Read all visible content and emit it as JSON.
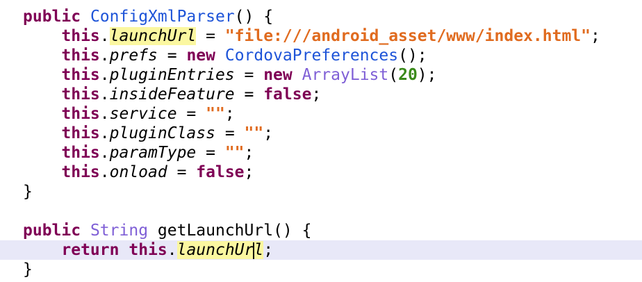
{
  "code": {
    "l1": {
      "kw": "public",
      "name": "ConfigXmlParser",
      "rest": "() {"
    },
    "l2": {
      "this": "this",
      "dot": ".",
      "field": "launchUrl",
      "eq": " = ",
      "value": "\"file:///android_asset/www/index.html\"",
      "end": ";"
    },
    "l3": {
      "this": "this",
      "dot": ".",
      "field": "prefs",
      "eq": " = ",
      "new": "new",
      "type": "CordovaPreferences",
      "end": "();"
    },
    "l4": {
      "this": "this",
      "dot": ".",
      "field": "pluginEntries",
      "eq": " = ",
      "new": "new",
      "type": "ArrayList",
      "open": "(",
      "num": "20",
      "end": ");"
    },
    "l5": {
      "this": "this",
      "dot": ".",
      "field": "insideFeature",
      "eq": " = ",
      "value": "false",
      "end": ";"
    },
    "l6": {
      "this": "this",
      "dot": ".",
      "field": "service",
      "eq": " = ",
      "value": "\"\"",
      "end": ";"
    },
    "l7": {
      "this": "this",
      "dot": ".",
      "field": "pluginClass",
      "eq": " = ",
      "value": "\"\"",
      "end": ";"
    },
    "l8": {
      "this": "this",
      "dot": ".",
      "field": "paramType",
      "eq": " = ",
      "value": "\"\"",
      "end": ";"
    },
    "l9": {
      "this": "this",
      "dot": ".",
      "field": "onload",
      "eq": " = ",
      "value": "false",
      "end": ";"
    },
    "l10": {
      "close": "}"
    },
    "l12": {
      "kw": "public",
      "type": "String",
      "name": "getLaunchUrl",
      "rest": "() {"
    },
    "l13": {
      "ret": "return",
      "this": "this",
      "dot": ".",
      "field_a": "launchUr",
      "field_b": "l",
      "end": ";"
    },
    "l14": {
      "close": "}"
    }
  },
  "colors": {
    "keyword": "#7f0055",
    "type": "#1e54d8",
    "string": "#e06b1f",
    "number": "#3a8a1a",
    "highlight": "#fbf7a0",
    "current_line": "#e8e8f8"
  }
}
